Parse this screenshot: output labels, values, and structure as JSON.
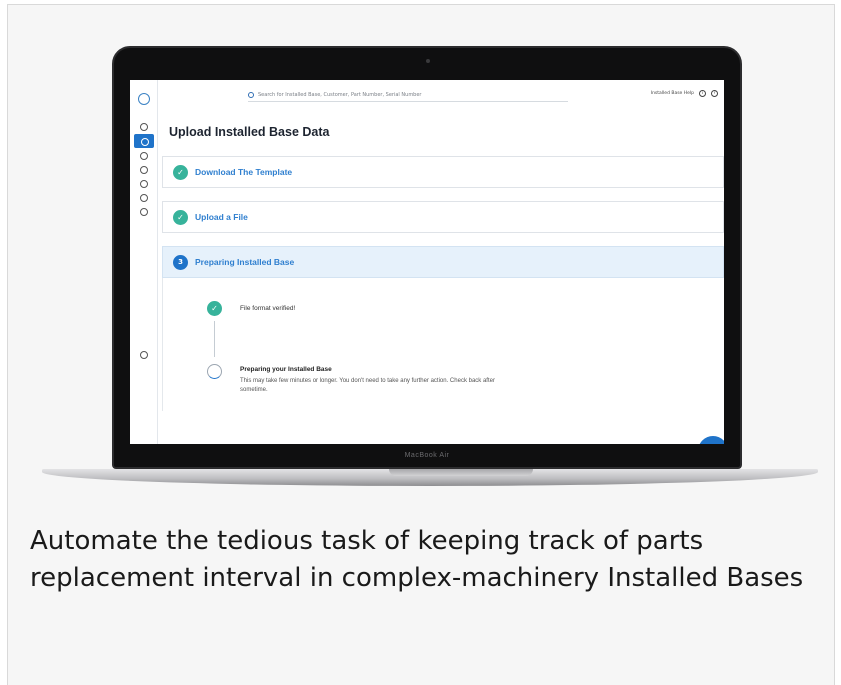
{
  "app": {
    "search_placeholder": "Search for Installed Base, Customer, Part Number, Serial Number",
    "top_link": "Installed Base Help",
    "info_icon_glyph": "i",
    "help_icon_glyph": "?",
    "page_title": "Upload Installed Base Data",
    "steps": [
      {
        "label": "Download The Template",
        "status": "complete",
        "badge": "✓"
      },
      {
        "label": "Upload a File",
        "status": "complete",
        "badge": "✓"
      },
      {
        "label": "Preparing Installed Base",
        "status": "current",
        "badge": "3"
      }
    ],
    "progress": {
      "done_text": "File format verified!",
      "pending_title": "Preparing your Installed Base",
      "pending_desc": "This may take few minutes or longer. You don't need to take any further action. Check back after sometime."
    }
  },
  "device": {
    "chin_label": "MacBook Air"
  },
  "caption": "Automate the tedious task of keeping track of parts replacement interval in complex-machinery Installed Bases",
  "colors": {
    "accent": "#1f73c9",
    "success": "#37b39b",
    "step_text": "#2f7fcf"
  },
  "icons": {
    "search": "search-icon",
    "check": "check-icon",
    "info": "info-icon",
    "help": "help-icon"
  }
}
